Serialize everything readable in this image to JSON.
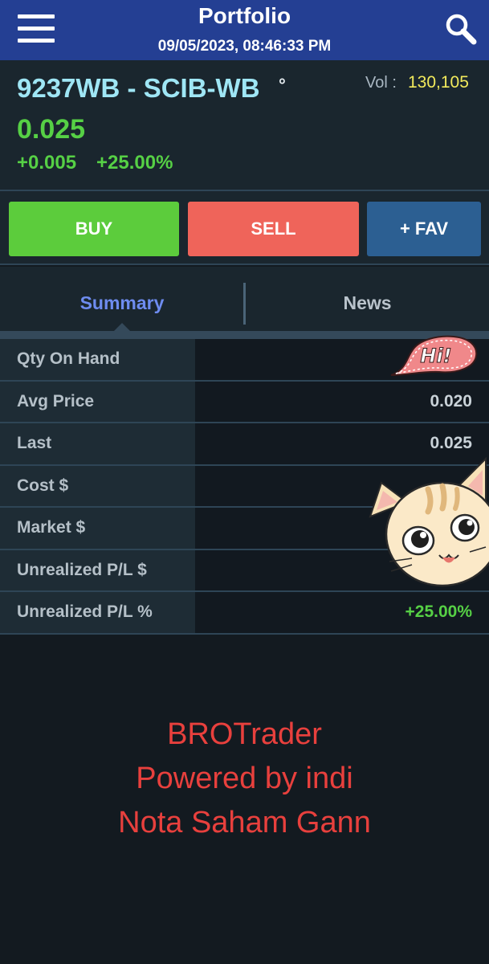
{
  "header": {
    "title": "Portfolio",
    "datetime": "09/05/2023, 08:46:33 PM",
    "menu_icon": "hamburger-menu-icon",
    "search_icon": "search-icon"
  },
  "quote": {
    "symbol": "9237WB - SCIB-WB",
    "indicator": "°",
    "vol_label": "Vol :",
    "vol_value": "130,105",
    "price": "0.025",
    "change": "+0.005",
    "change_pct": "+25.00%"
  },
  "actions": {
    "buy": "BUY",
    "sell": "SELL",
    "fav": "+ FAV"
  },
  "tabs": [
    {
      "label": "Summary",
      "active": true
    },
    {
      "label": "News",
      "active": false
    }
  ],
  "summary_rows": [
    {
      "label": "Qty On Hand",
      "value": ""
    },
    {
      "label": "Avg Price",
      "value": "0.020"
    },
    {
      "label": "Last",
      "value": "0.025"
    },
    {
      "label": "Cost $",
      "value": ""
    },
    {
      "label": "Market $",
      "value": ""
    },
    {
      "label": "Unrealized P/L $",
      "value": ""
    },
    {
      "label": "Unrealized P/L %",
      "value": "+25.00%"
    }
  ],
  "watermark": {
    "line1": "BROTrader",
    "line2": "Powered by indi",
    "line3": "Nota Saham Gann"
  },
  "stickers": {
    "speech_bubble_text": "Hi!"
  },
  "colors": {
    "header_bg": "#243f93",
    "buy": "#5ccc3c",
    "sell": "#ef645a",
    "fav": "#2c5f92",
    "positive": "#56d045",
    "symbol": "#9fe6f5",
    "volume": "#f2ea5c",
    "watermark": "#e8403d"
  }
}
